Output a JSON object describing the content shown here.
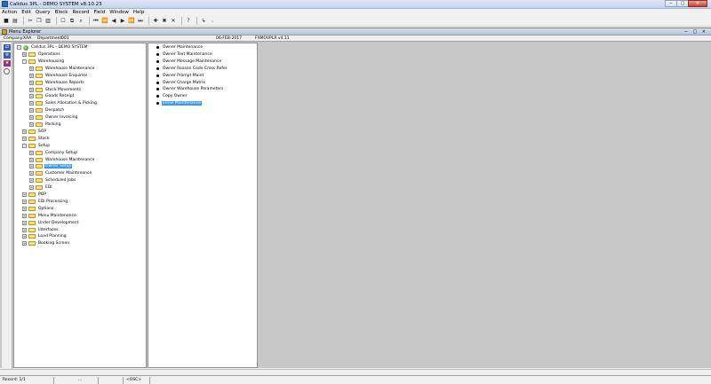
{
  "window": {
    "title": "Calidus 3PL - DEMO SYSTEM v8.10.23"
  },
  "menu": [
    "Action",
    "Edit",
    "Query",
    "Block",
    "Record",
    "Field",
    "Window",
    "Help"
  ],
  "toolbar": {
    "icons": [
      "save-icon",
      "print-icon",
      "cut-icon",
      "copy-icon",
      "paste-icon",
      "clear-icon",
      "duplicate-icon",
      "search-icon",
      "first-record-icon",
      "prev-set-icon",
      "prev-record-icon",
      "next-record-icon",
      "next-set-icon",
      "last-record-icon",
      "insert-record-icon",
      "delete-record-icon",
      "clear-record-icon",
      "help-icon",
      "exit-icon",
      "exit-menu-icon"
    ],
    "glyphs": [
      "■",
      "▤",
      "✂",
      "❐",
      "▥",
      "☐",
      "⧉",
      "⌕",
      "⏮",
      "⏪",
      "◀",
      "▶",
      "⏩",
      "⏭",
      "✚",
      "✖",
      "✕",
      "?",
      "↳",
      "⌄"
    ]
  },
  "inner_window": {
    "title": "Menu Explorer",
    "controls": "− □ ×",
    "info": {
      "company_label": "Company:",
      "company_value": "XAA",
      "department_label": "Department:",
      "department_value": "001",
      "date": "06-FEB-2017",
      "form": "FXMOVPLR  v4.11"
    }
  },
  "tree": {
    "root": "Calidus 3PL - DEMO SYSTEM",
    "nodes": [
      {
        "label": "Operations",
        "level": 1,
        "toggle": "+"
      },
      {
        "label": "Warehousing",
        "level": 1,
        "toggle": "-"
      },
      {
        "label": "Warehouse Maintenance",
        "level": 2,
        "toggle": "+"
      },
      {
        "label": "Warehouse Enquiries",
        "level": 2,
        "toggle": "+"
      },
      {
        "label": "Warehouse Reports",
        "level": 2,
        "toggle": "+"
      },
      {
        "label": "Stock Movements",
        "level": 2,
        "toggle": "+"
      },
      {
        "label": "Goods Receipt",
        "level": 2,
        "toggle": "+"
      },
      {
        "label": "Sales Allocation & Picking",
        "level": 2,
        "toggle": "+"
      },
      {
        "label": "Despatch",
        "level": 2,
        "toggle": "+"
      },
      {
        "label": "Owner Invoicing",
        "level": 2,
        "toggle": "+"
      },
      {
        "label": "Packing",
        "level": 2,
        "toggle": "+"
      },
      {
        "label": "SOP",
        "level": 1,
        "toggle": "+"
      },
      {
        "label": "Stock",
        "level": 1,
        "toggle": "+"
      },
      {
        "label": "Setup",
        "level": 1,
        "toggle": "-"
      },
      {
        "label": "Company Setup",
        "level": 2,
        "toggle": "+"
      },
      {
        "label": "Warehouse Maintenance",
        "level": 2,
        "toggle": "+"
      },
      {
        "label": "Owner Setup",
        "level": 2,
        "toggle": "+",
        "selected": true
      },
      {
        "label": "Customer Maintenance",
        "level": 2,
        "toggle": "+"
      },
      {
        "label": "Scheduled Jobs",
        "level": 2,
        "toggle": "+"
      },
      {
        "label": "EDI",
        "level": 2,
        "toggle": "+"
      },
      {
        "label": "POP",
        "level": 1,
        "toggle": "+"
      },
      {
        "label": "EDI Processing",
        "level": 1,
        "toggle": "+"
      },
      {
        "label": "Options",
        "level": 1,
        "toggle": "+"
      },
      {
        "label": "Menu Maintenance",
        "level": 1,
        "toggle": "+"
      },
      {
        "label": "Under Development",
        "level": 1,
        "toggle": "+"
      },
      {
        "label": "Interfaces",
        "level": 1,
        "toggle": "+"
      },
      {
        "label": "Load Planning",
        "level": 1,
        "toggle": "+"
      },
      {
        "label": "Booking Screen",
        "level": 1,
        "toggle": "+"
      }
    ]
  },
  "list": {
    "items": [
      {
        "label": "Owner Maintenance"
      },
      {
        "label": "Owner Text Maintenance"
      },
      {
        "label": "Owner Message Maintenance"
      },
      {
        "label": "Owner Reason Code Cross Refer"
      },
      {
        "label": "Owner Prompt Maint"
      },
      {
        "label": "Owner Charge Matrix"
      },
      {
        "label": "Owner Warehouse Parameters"
      },
      {
        "label": "Copy Owner"
      },
      {
        "label": "Email Maintenance",
        "selected": true
      }
    ]
  },
  "statusbar": {
    "record": "Record: 1/1",
    "segment": "...",
    "mode": "<OSC>"
  },
  "colors": {
    "selection": "#3399ff",
    "workspace": "#c8c8c8"
  }
}
